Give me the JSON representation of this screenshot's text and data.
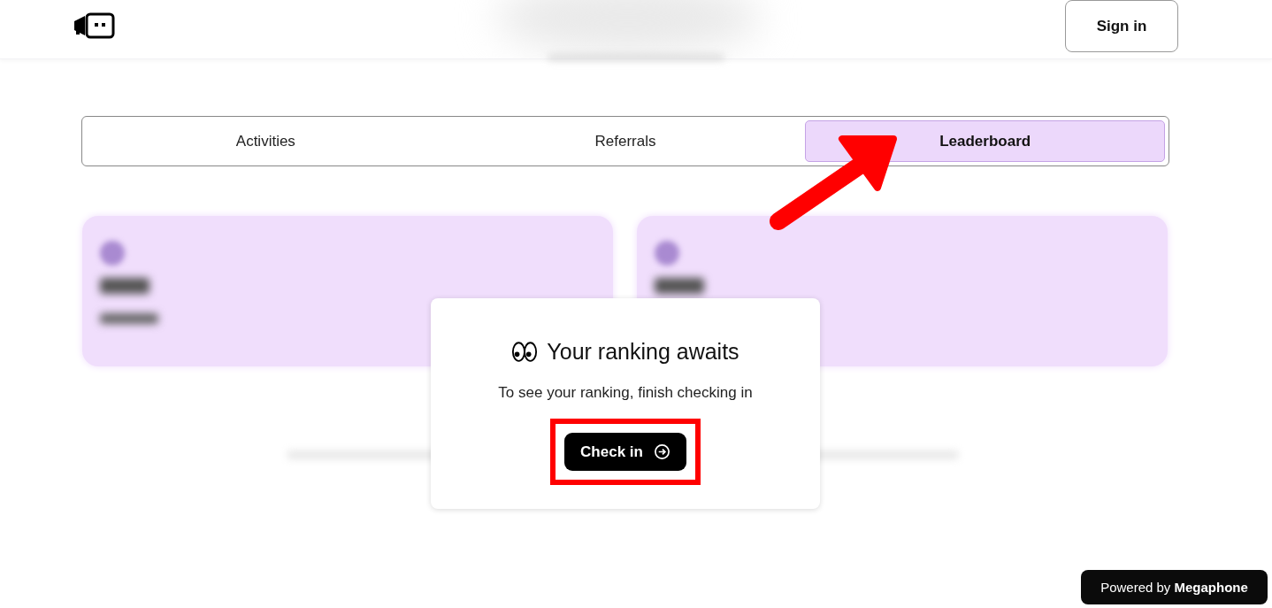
{
  "header": {
    "sign_in": "Sign in"
  },
  "tabs": [
    {
      "label": "Activities",
      "selected": false
    },
    {
      "label": "Referrals",
      "selected": false
    },
    {
      "label": "Leaderboard",
      "selected": true
    }
  ],
  "modal": {
    "title": "Your ranking awaits",
    "message": "To see your ranking, finish checking in",
    "button": "Check in"
  },
  "badge": "Powered by **Megaphone**"
}
